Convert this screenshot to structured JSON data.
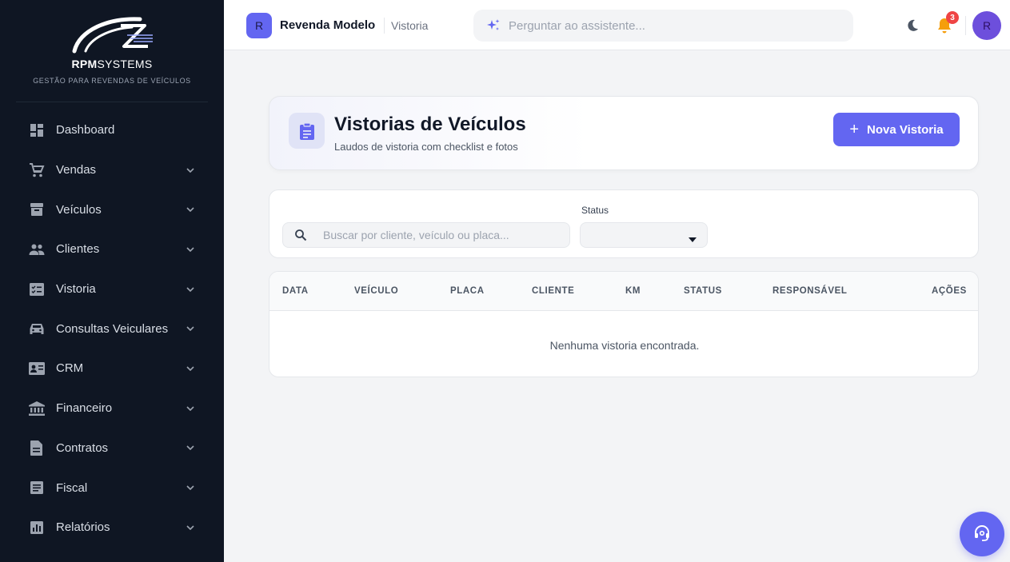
{
  "brand": {
    "name_bold": "RPM",
    "name_rest": "SYSTEMS",
    "tagline": "GESTÃO PARA REVENDAS DE VEÍCULOS"
  },
  "sidebar": {
    "items": [
      {
        "label": "Dashboard",
        "icon": "dashboard-icon",
        "has_chevron": false
      },
      {
        "label": "Vendas",
        "icon": "cart-icon",
        "has_chevron": true
      },
      {
        "label": "Veículos",
        "icon": "archive-box-icon",
        "has_chevron": true
      },
      {
        "label": "Clientes",
        "icon": "people-icon",
        "has_chevron": true
      },
      {
        "label": "Vistoria",
        "icon": "checklist-icon",
        "has_chevron": true
      },
      {
        "label": "Consultas Veiculares",
        "icon": "car-icon",
        "has_chevron": true
      },
      {
        "label": "CRM",
        "icon": "contact-card-icon",
        "has_chevron": true
      },
      {
        "label": "Financeiro",
        "icon": "bank-icon",
        "has_chevron": true
      },
      {
        "label": "Contratos",
        "icon": "document-icon",
        "has_chevron": true
      },
      {
        "label": "Fiscal",
        "icon": "list-document-icon",
        "has_chevron": true
      },
      {
        "label": "Relatórios",
        "icon": "bar-chart-icon",
        "has_chevron": true
      }
    ]
  },
  "topbar": {
    "org_initial": "R",
    "org_name": "Revenda Modelo",
    "breadcrumb": "Vistoria",
    "assistant_placeholder": "Perguntar ao assistente...",
    "notification_count": "3",
    "user_initial": "R"
  },
  "header": {
    "title": "Vistorias de Veículos",
    "subtitle": "Laudos de vistoria com checklist e fotos",
    "new_button_label": "Nova Vistoria"
  },
  "filters": {
    "search_placeholder": "Buscar por cliente, veículo ou placa...",
    "search_value": "",
    "status_label": "Status",
    "status_value": ""
  },
  "table": {
    "columns": [
      "DATA",
      "VEÍCULO",
      "PLACA",
      "CLIENTE",
      "KM",
      "STATUS",
      "RESPONSÁVEL",
      "AÇÕES"
    ],
    "empty_message": "Nenhuma vistoria encontrada."
  },
  "colors": {
    "sidebar_bg": "#0f1623",
    "accent": "#6366f1",
    "page_bg": "#f3f4f6",
    "notification": "#ef4444",
    "bell": "#f59e0b"
  }
}
